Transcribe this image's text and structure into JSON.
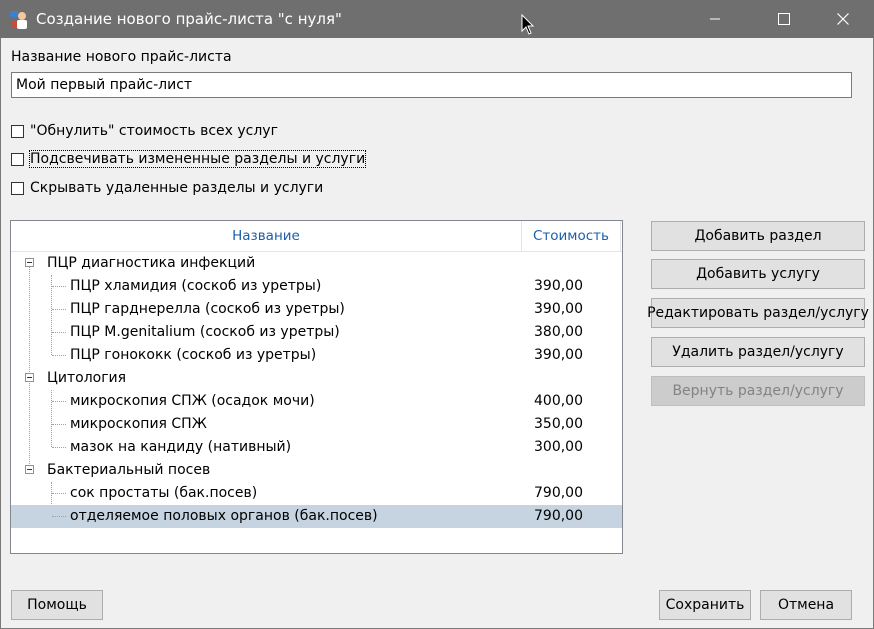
{
  "window": {
    "title": "Создание нового прайс-листа \"с нуля\"",
    "controls": {
      "minimize": "—",
      "maximize": "☐",
      "close": "✕"
    }
  },
  "form": {
    "name_label": "Название нового прайс-листа",
    "name_value": "Мой первый прайс-лист",
    "checkboxes": [
      {
        "label": "\"Обнулить\" стоимость всех услуг",
        "checked": false
      },
      {
        "label": "Подсвечивать измененные разделы и услуги",
        "checked": false
      },
      {
        "label": "Скрывать удаленные разделы и услуги",
        "checked": false
      }
    ]
  },
  "tree": {
    "columns": {
      "name": "Название",
      "cost": "Стоимость"
    },
    "sections": [
      {
        "name": "ПЦР диагностика инфекций",
        "items": [
          {
            "name": "ПЦР хламидия (соскоб из уретры)",
            "cost": "390,00"
          },
          {
            "name": "ПЦР гарднерелла (соскоб из уретры)",
            "cost": "390,00"
          },
          {
            "name": "ПЦР M.genitalium (соскоб из уретры)",
            "cost": "380,00"
          },
          {
            "name": "ПЦР гонококк (соскоб из уретры)",
            "cost": "390,00"
          }
        ]
      },
      {
        "name": "Цитология",
        "items": [
          {
            "name": "микроскопия СПЖ (осадок мочи)",
            "cost": "400,00"
          },
          {
            "name": "микроскопия СПЖ",
            "cost": "350,00"
          },
          {
            "name": "мазок на кандиду (нативный)",
            "cost": "300,00"
          }
        ]
      },
      {
        "name": "Бактериальный посев",
        "items": [
          {
            "name": "сок простаты (бак.посев)",
            "cost": "790,00"
          },
          {
            "name": "отделяемое половых органов (бак.посев)",
            "cost": "790,00",
            "selected": true
          }
        ]
      }
    ]
  },
  "side_buttons": {
    "add_section": "Добавить раздел",
    "add_service": "Добавить услугу",
    "edit": "Редактировать раздел/услугу",
    "delete": "Удалить раздел/услугу",
    "restore": "Вернуть раздел/услугу"
  },
  "footer": {
    "help": "Помощь",
    "save": "Сохранить",
    "cancel": "Отмена"
  },
  "colors": {
    "titlebar": "#6f6f6f",
    "selection": "#c5d4e0",
    "header_text": "#1c5fa8"
  }
}
